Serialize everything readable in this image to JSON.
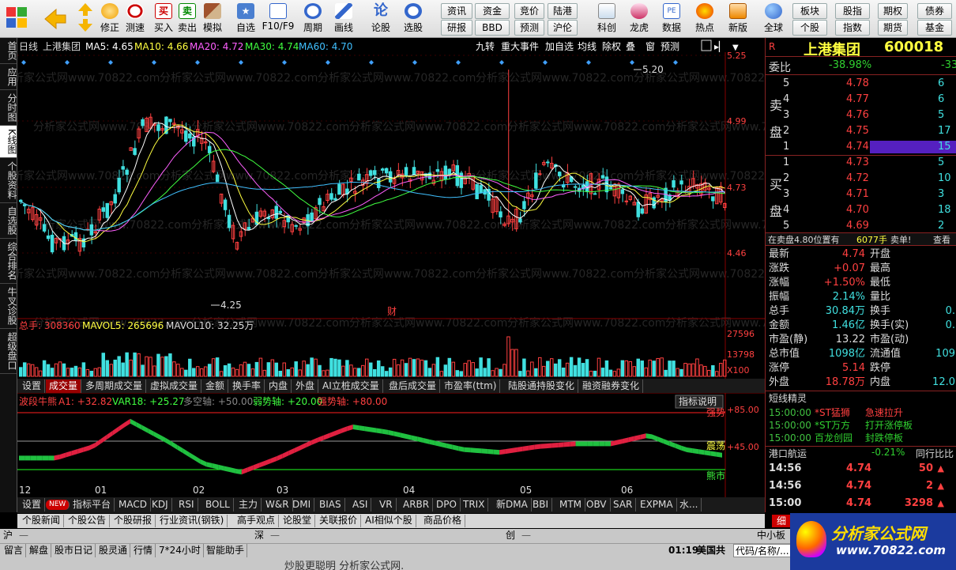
{
  "toolbar": {
    "big": [
      "买入",
      "卖出",
      "模拟",
      "自选",
      "F10/F9",
      "周期",
      "画线",
      "论股",
      "选股"
    ],
    "nav": [
      "修正",
      "刷新",
      "测速"
    ],
    "small_top": [
      "资讯",
      "资金",
      "竞价",
      "陆港",
      "板块",
      "股指",
      "期权",
      "债券"
    ],
    "small_bottom": [
      "研报",
      "BBD",
      "预测",
      "沪伦",
      "个股",
      "指数",
      "期货",
      "基金"
    ],
    "icons": [
      "科创",
      "龙虎",
      "数据",
      "热点",
      "新版",
      "全球"
    ]
  },
  "left_tabs": [
    "首页",
    "应用",
    "分时图",
    "K线图",
    "个股资料",
    "自选股",
    "综合排名",
    "牛叉诊股",
    "超级盘口"
  ],
  "chart": {
    "period": "日线",
    "name": "上港集团",
    "ma": [
      {
        "label": "MA5: 4.65",
        "color": "#ffffff"
      },
      {
        "label": "MA10: 4.66",
        "color": "#ffff40"
      },
      {
        "label": "MA20: 4.72",
        "color": "#ff60ff"
      },
      {
        "label": "MA30: 4.74",
        "color": "#40ff40"
      },
      {
        "label": "MA60: 4.70",
        "color": "#40c0ff"
      }
    ],
    "toolbtns": [
      "九转",
      "重大事件",
      "加自选",
      "均线",
      "除权",
      "叠",
      "窗",
      "预测"
    ],
    "price_ticks": [
      "5.25",
      "4.99",
      "4.73",
      "4.46"
    ],
    "high_label": "5.20",
    "low_label": "4.25",
    "cai": "财",
    "vol_header": {
      "total": "总手: 308360",
      "mavol5": "MAVOL5: 265696",
      "mavol10": "MAVOL10: 32.25万"
    },
    "vol_ticks": [
      "27596",
      "13798",
      "X100"
    ],
    "ind_header": {
      "name": "波段牛熊",
      "a1": "A1: +32.82",
      "var": "VAR18: +25.27",
      "kong": "多空轴: +50.00",
      "weak": "弱势轴: +20.00",
      "strong": "强势轴: +80.00",
      "explain": "指标说明"
    },
    "ind_ticks": [
      "+85.00",
      "+45.00"
    ],
    "ind_zone": [
      "强势",
      "震荡",
      "熊市"
    ],
    "months": [
      "12",
      "01",
      "02",
      "03",
      "04",
      "05",
      "06"
    ],
    "watermark": "分析家公式网www.70822.com"
  },
  "vol_tabs": [
    "设置",
    "成交量",
    "多周期成交量",
    "虚拟成交量",
    "金额",
    "换手率",
    "内盘",
    "外盘",
    "AI立桩成交量",
    "盘后成交量",
    "市盈率(ttm)",
    "陆股通持股变化",
    "融资融券变化"
  ],
  "ind_tabs": [
    "设置",
    "NEW",
    "指标平台",
    "MACD",
    "KDJ",
    "RSI",
    "BOLL",
    "主力",
    "W&R",
    "DMI",
    "BIAS",
    "ASI",
    "VR",
    "ARBR",
    "DPO",
    "TRIX",
    "新DMA",
    "BBI",
    "MTM",
    "OBV",
    "SAR",
    "EXPMA",
    "水..."
  ],
  "news_tabs": [
    "个股新闻",
    "个股公告",
    "个股研报",
    "行业资讯(钢铁)",
    "高手观点",
    "论股堂",
    "关联报价",
    "AI相似个股",
    "商品价格"
  ],
  "quote": {
    "r": "R",
    "name": "上港集团",
    "code": "600018",
    "weibi_label": "委比",
    "weibi": "-38.98%",
    "weibi2": "-33",
    "sell_label": "卖",
    "buy_label": "买",
    "pan": "盘",
    "asks": [
      {
        "n": "5",
        "p": "4.78",
        "v": "6"
      },
      {
        "n": "4",
        "p": "4.77",
        "v": "6"
      },
      {
        "n": "3",
        "p": "4.76",
        "v": "5"
      },
      {
        "n": "2",
        "p": "4.75",
        "v": "17"
      },
      {
        "n": "1",
        "p": "4.74",
        "v": "15"
      }
    ],
    "bids": [
      {
        "n": "1",
        "p": "4.73",
        "v": "5"
      },
      {
        "n": "2",
        "p": "4.72",
        "v": "10"
      },
      {
        "n": "3",
        "p": "4.71",
        "v": "3"
      },
      {
        "n": "4",
        "p": "4.70",
        "v": "18"
      },
      {
        "n": "5",
        "p": "4.69",
        "v": "2"
      }
    ],
    "info": "在卖盘4.80位置有",
    "info_vol": "6077手",
    "info_tag": "卖单!",
    "info_see": "查看",
    "stats": [
      {
        "l": "最新",
        "v": "4.74",
        "c": "red",
        "l2": "开盘",
        "v2": ""
      },
      {
        "l": "涨跌",
        "v": "+0.07",
        "c": "red",
        "l2": "最高",
        "v2": ""
      },
      {
        "l": "涨幅",
        "v": "+1.50%",
        "c": "red",
        "l2": "最低",
        "v2": ""
      },
      {
        "l": "振幅",
        "v": "2.14%",
        "c": "cyan",
        "l2": "量比",
        "v2": ""
      },
      {
        "l": "总手",
        "v": "30.84万",
        "c": "cyan",
        "l2": "换手",
        "v2": "0."
      },
      {
        "l": "金额",
        "v": "1.46亿",
        "c": "cyan",
        "l2": "换手(实)",
        "v2": "0."
      },
      {
        "l": "市盈(静)",
        "v": "13.22",
        "c": "white",
        "l2": "市盈(动)",
        "v2": ""
      },
      {
        "l": "总市值",
        "v": "1098亿",
        "c": "cyan",
        "l2": "流通值",
        "v2": "109"
      },
      {
        "l": "涨停",
        "v": "5.14",
        "c": "red",
        "l2": "跌停",
        "v2": ""
      },
      {
        "l": "外盘",
        "v": "18.78万",
        "c": "red",
        "l2": "内盘",
        "v2": "12.0"
      }
    ],
    "short_title": "短线精灵",
    "short": [
      {
        "t": "15:00:00",
        "n": "*ST猛狮",
        "e": "急速拉升",
        "c": "red"
      },
      {
        "t": "15:00:00",
        "n": "*ST万方",
        "e": "打开涨停板",
        "c": "green"
      },
      {
        "t": "15:00:00",
        "n": "百龙创园",
        "e": "封跌停板",
        "c": "green"
      }
    ],
    "port": "港口航运",
    "port_pct": "-0.21%",
    "port_rank": "同行比比",
    "ticks": [
      {
        "t": "14:56",
        "p": "4.74",
        "v": "50"
      },
      {
        "t": "14:56",
        "p": "4.74",
        "v": "2"
      },
      {
        "t": "15:00",
        "p": "4.74",
        "v": "3298"
      }
    ],
    "detail_tab": "细"
  },
  "status": {
    "mkt": [
      {
        "l": "沪",
        "v": "—"
      },
      {
        "l": "深",
        "v": "—"
      },
      {
        "l": "创",
        "v": "—"
      },
      {
        "l": "中小板",
        "v": ""
      }
    ],
    "btns": [
      "留言",
      "解盘",
      "股市日记",
      "股灵通",
      "行情",
      "7*24小时",
      "智能助手"
    ],
    "time": "01:19",
    "region": "美国共",
    "search": "代码/名称/...",
    "ticker": "炒股更聪明 分析家公式网.",
    "logo_title": "分析家公式网",
    "logo_url": "www.70822.com"
  }
}
